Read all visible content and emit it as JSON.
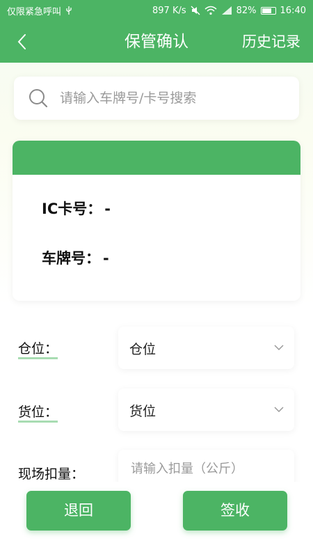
{
  "status_bar": {
    "carrier": "仅限紧急呼叫",
    "speed": "897 K/s",
    "battery": "82%",
    "time": "16:40"
  },
  "header": {
    "title": "保管确认",
    "history": "历史记录"
  },
  "search": {
    "placeholder": "请输入车牌号/卡号搜索"
  },
  "card": {
    "ic_label": "IC卡号：",
    "ic_value": "-",
    "plate_label": "车牌号：",
    "plate_value": "-"
  },
  "form": {
    "warehouse_label": "仓位：",
    "warehouse_value": "仓位",
    "cargo_label": "货位：",
    "cargo_value": "货位",
    "weight_label": "现场扣量：",
    "weight_placeholder": "请输入扣量（公斤）"
  },
  "actions": {
    "return": "退回",
    "sign": "签收"
  },
  "colors": {
    "primary": "#4cb464",
    "underline": "#a8dcb2"
  }
}
